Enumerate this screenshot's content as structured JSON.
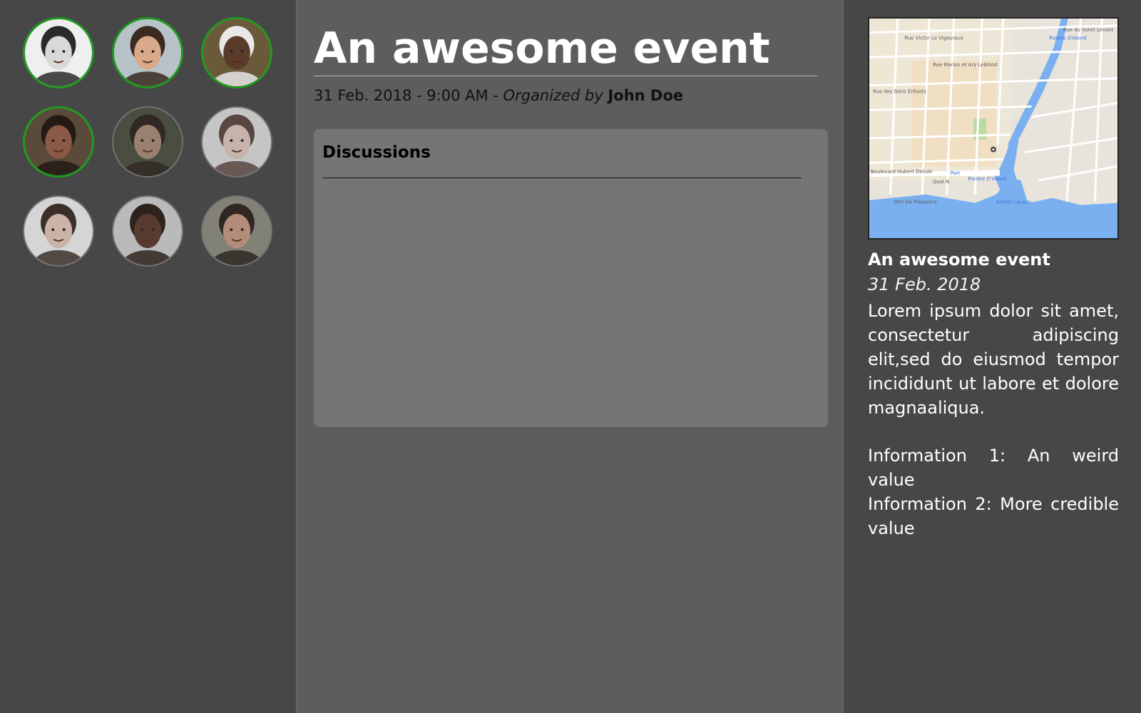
{
  "participants": [
    {
      "name": "participant-1",
      "status": "online",
      "skin": "#d9d9d9",
      "hair": "#2a2a2a",
      "bg": "#efefef"
    },
    {
      "name": "participant-2",
      "status": "online",
      "skin": "#d9a98a",
      "hair": "#3a2a1f",
      "bg": "#b7c3c9"
    },
    {
      "name": "participant-3",
      "status": "online",
      "skin": "#5a3a28",
      "hair": "#e8e8e8",
      "bg": "#6a5a3a"
    },
    {
      "name": "participant-4",
      "status": "online",
      "skin": "#8a5a44",
      "hair": "#231a16",
      "bg": "#5a4a3a"
    },
    {
      "name": "participant-5",
      "status": "offline",
      "skin": "#a88a76",
      "hair": "#2e2320",
      "bg": "#4a5040"
    },
    {
      "name": "participant-6",
      "status": "offline",
      "skin": "#ddc6bd",
      "hair": "#5a4640",
      "bg": "#dcdcdc"
    },
    {
      "name": "participant-7",
      "status": "offline",
      "skin": "#e2c8b8",
      "hair": "#3a2b26",
      "bg": "#eeeeee"
    },
    {
      "name": "participant-8",
      "status": "offline",
      "skin": "#5a3a2c",
      "hair": "#2a1c16",
      "bg": "#cfcfcf"
    },
    {
      "name": "participant-9",
      "status": "offline",
      "skin": "#c89a84",
      "hair": "#2c221e",
      "bg": "#8c8c80"
    }
  ],
  "event": {
    "title": "An awesome event",
    "datetime": "31 Feb. 2018 - 9:00 AM - ",
    "organized_by_label": "Organized by",
    "organizer": "John Doe"
  },
  "discussions": {
    "title": "Discussions"
  },
  "sidebar": {
    "title": "An awesome event",
    "date": "31 Feb. 2018",
    "description": "Lorem ipsum dolor sit amet, consectetur adipiscing elit,sed do eiusmod tempor incididunt ut labore et dolore magnaaliqua.",
    "info": [
      "Information 1: An weird value",
      "Information 2: More credible value"
    ],
    "map_labels": [
      "Rue Victor Le Vigoureux",
      "Rue Marius et Ary Leblond",
      "Rue des Bons Enfants",
      "Rue du Soleil Levant",
      "Port",
      "Rivière D'Abord",
      "Port De Plaisance",
      "Amiral Lacaze",
      "Ravine d'Abord",
      "Quai N",
      "Boulevard Hubert Delisle"
    ]
  }
}
